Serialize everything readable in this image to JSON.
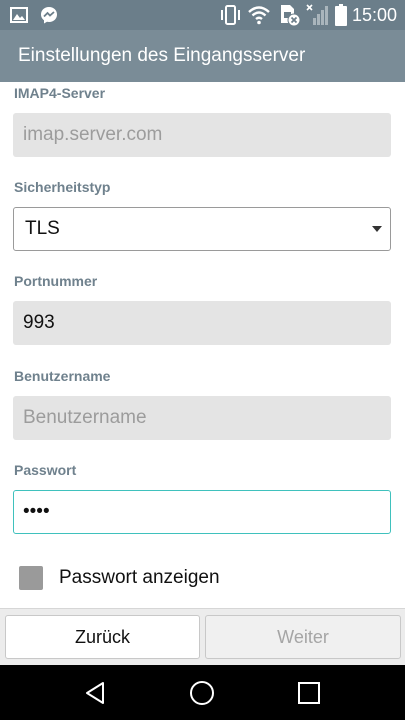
{
  "status_bar": {
    "time": "15:00",
    "left_icons": [
      "image-icon",
      "messenger-icon"
    ],
    "right_icons": [
      "vibrate-icon",
      "wifi-icon",
      "no-sim-icon",
      "signal-icon",
      "battery-icon"
    ]
  },
  "header": {
    "title": "Einstellungen des Eingangsserver"
  },
  "form": {
    "imap_server": {
      "label": "IMAP4-Server",
      "placeholder": "imap.server.com",
      "value": ""
    },
    "security_type": {
      "label": "Sicherheitstyp",
      "selected": "TLS"
    },
    "port": {
      "label": "Portnummer",
      "value": "993"
    },
    "username": {
      "label": "Benutzername",
      "placeholder": "Benutzername",
      "value": ""
    },
    "password": {
      "label": "Passwort",
      "value": "••••"
    },
    "show_password": {
      "label": "Passwort anzeigen",
      "checked": false
    }
  },
  "buttons": {
    "back_label": "Zurück",
    "next_label": "Weiter",
    "next_enabled": false
  },
  "nav_bar": {
    "icons": [
      "back-triangle-icon",
      "home-circle-icon",
      "recents-square-icon"
    ]
  },
  "colors": {
    "status_bar_bg": "#6b7e8a",
    "title_bar_bg": "#7a8c97",
    "label_color": "#6f818d",
    "focus_border": "#3fc1bd",
    "input_bg": "#e4e4e4"
  }
}
